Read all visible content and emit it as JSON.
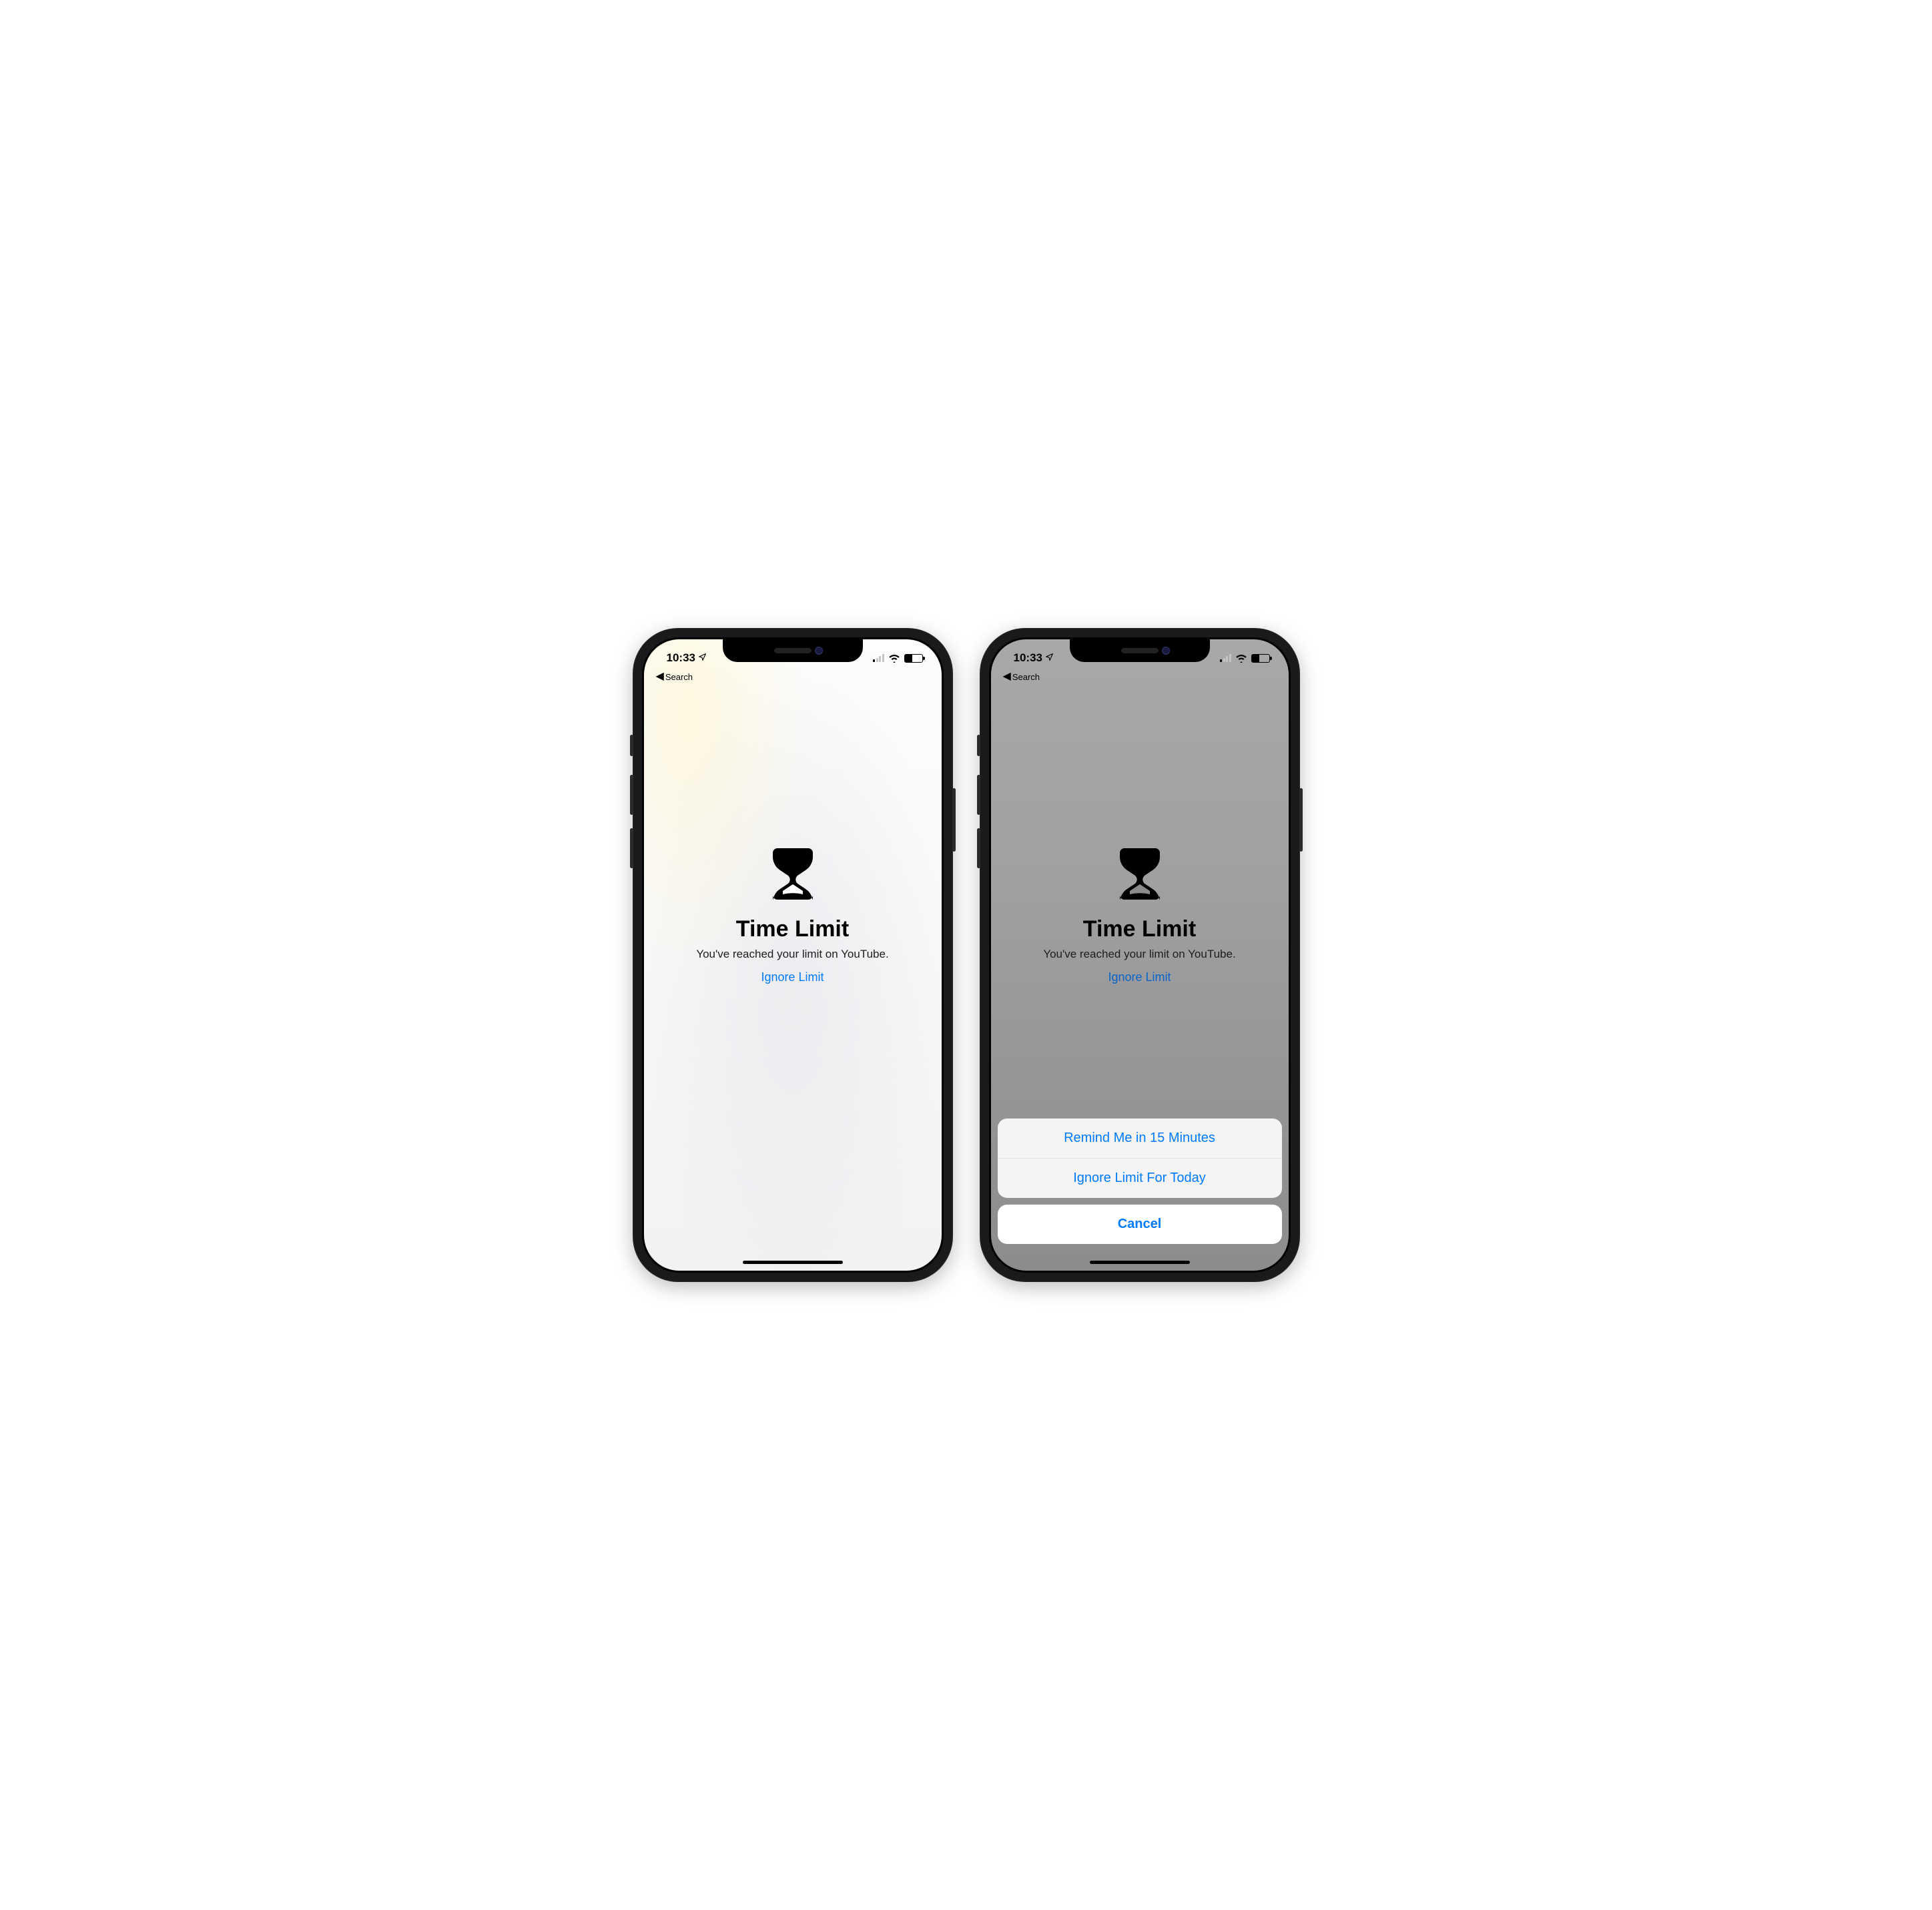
{
  "statusbar": {
    "time": "10:33",
    "back_label": "Search"
  },
  "screen": {
    "title": "Time Limit",
    "subtitle": "You've reached your limit on YouTube.",
    "ignore_link": "Ignore Limit"
  },
  "action_sheet": {
    "options": [
      "Remind Me in 15 Minutes",
      "Ignore Limit For Today"
    ],
    "cancel": "Cancel"
  }
}
